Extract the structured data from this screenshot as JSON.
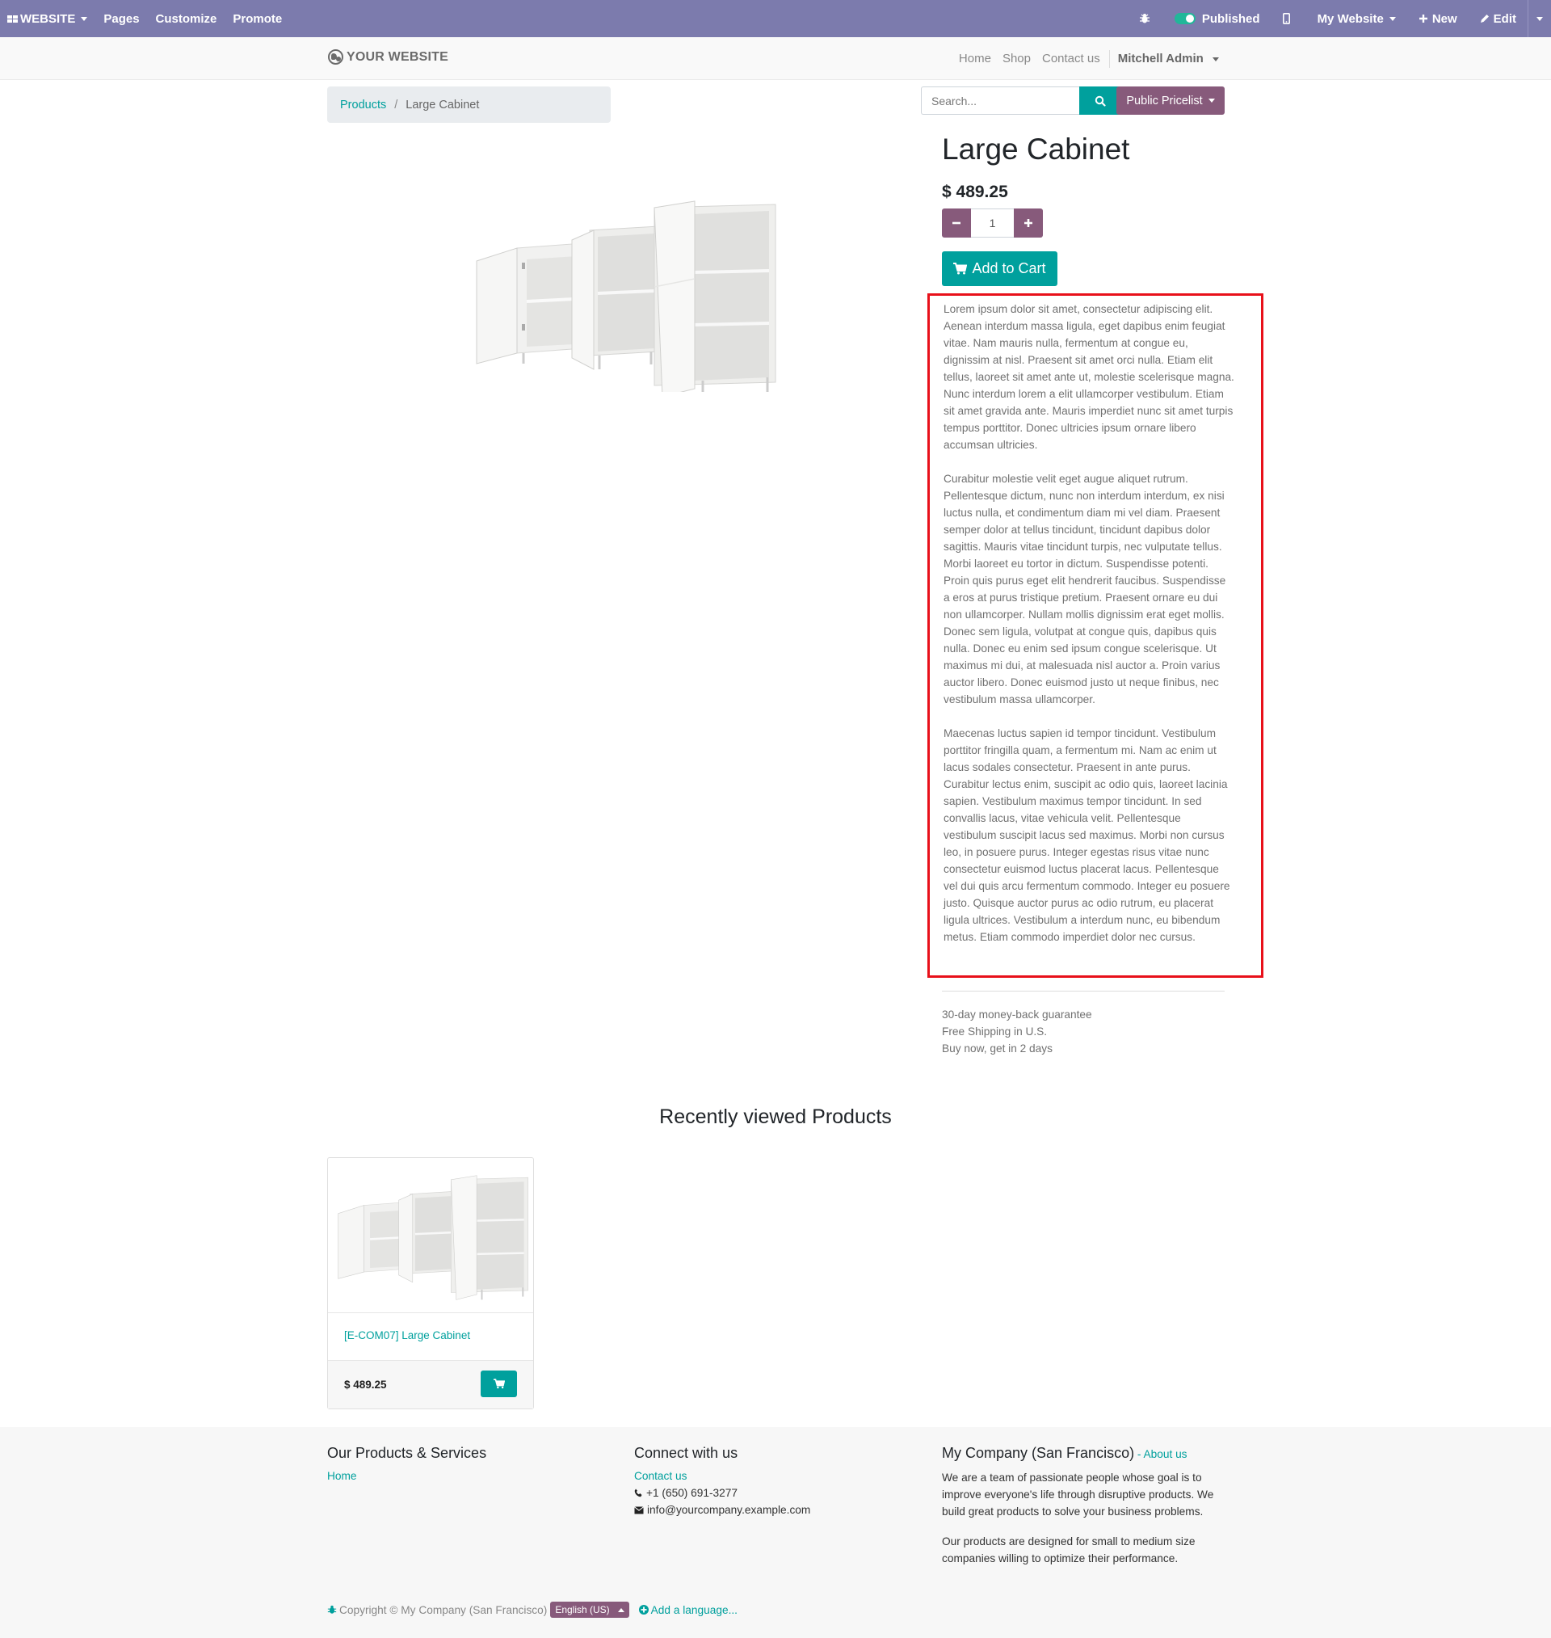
{
  "adminbar": {
    "apps_label": "WEBSITE",
    "pages_label": "Pages",
    "customize_label": "Customize",
    "promote_label": "Promote",
    "published_label": "Published",
    "site_label": "My Website",
    "new_label": "New",
    "edit_label": "Edit"
  },
  "header": {
    "logo_text": "YOUR WEBSITE",
    "nav": [
      "Home",
      "Shop",
      "Contact us"
    ],
    "user": "Mitchell Admin"
  },
  "breadcrumb": {
    "parent": "Products",
    "separator": "/",
    "current": "Large Cabinet"
  },
  "search": {
    "placeholder": "Search..."
  },
  "pricelist": {
    "label": "Public Pricelist"
  },
  "product": {
    "name": "Large Cabinet",
    "price": "$ 489.25",
    "quantity": "1",
    "add_to_cart_label": "Add to Cart",
    "description": [
      "Lorem ipsum dolor sit amet, consectetur adipiscing elit. Aenean interdum massa ligula, eget dapibus enim feugiat vitae. Nam mauris nulla, fermentum at congue eu, dignissim at nisl. Praesent sit amet orci nulla. Etiam elit tellus, laoreet sit amet ante ut, molestie scelerisque magna. Nunc interdum lorem a elit ullamcorper vestibulum. Etiam sit amet gravida ante. Mauris imperdiet nunc sit amet turpis tempus porttitor. Donec ultricies ipsum ornare libero accumsan ultricies.",
      "Curabitur molestie velit eget augue aliquet rutrum. Pellentesque dictum, nunc non interdum interdum, ex nisi luctus nulla, et condimentum diam mi vel diam. Praesent semper dolor at tellus tincidunt, tincidunt dapibus dolor sagittis. Mauris vitae tincidunt turpis, nec vulputate tellus. Morbi laoreet eu tortor in dictum. Suspendisse potenti. Proin quis purus eget elit hendrerit faucibus. Suspendisse a eros at purus tristique pretium. Praesent ornare eu dui non ullamcorper. Nullam mollis dignissim erat eget mollis. Donec sem ligula, volutpat at congue quis, dapibus quis nulla. Donec eu enim sed ipsum congue scelerisque. Ut maximus mi dui, at malesuada nisl auctor a. Proin varius auctor libero. Donec euismod justo ut neque finibus, nec vestibulum massa ullamcorper.",
      "Maecenas luctus sapien id tempor tincidunt. Vestibulum porttitor fringilla quam, a fermentum mi. Nam ac enim ut lacus sodales consectetur. Praesent in ante purus. Curabitur lectus enim, suscipit ac odio quis, laoreet lacinia sapien. Vestibulum maximus tempor tincidunt. In sed convallis lacus, vitae vehicula velit. Pellentesque vestibulum suscipit lacus sed maximus. Morbi non cursus leo, in posuere purus. Integer egestas risus vitae nunc consectetur euismod luctus placerat lacus. Pellentesque vel dui quis arcu fermentum commodo. Integer eu posuere justo. Quisque auctor purus ac odio rutrum, eu placerat ligula ultrices. Vestibulum a interdum nunc, eu bibendum metus. Etiam commodo imperdiet dolor nec cursus."
    ],
    "guarantees": [
      "30-day money-back guarantee",
      "Free Shipping in U.S.",
      "Buy now, get in 2 days"
    ]
  },
  "recent": {
    "title": "Recently viewed Products",
    "items": [
      {
        "name": "[E-COM07] Large Cabinet",
        "price": "$ 489.25"
      }
    ]
  },
  "footer": {
    "col1": {
      "title": "Our Products & Services",
      "link": "Home"
    },
    "col2": {
      "title": "Connect with us",
      "contact": "Contact us",
      "phone": "+1 (650) 691-3277",
      "email": "info@yourcompany.example.com"
    },
    "col3": {
      "title": "My Company (San Francisco)",
      "about_sep": " - ",
      "about_link": "About us",
      "p1": "We are a team of passionate people whose goal is to improve everyone's life through disruptive products. We build great products to solve your business problems.",
      "p2": "Our products are designed for small to medium size companies willing to optimize their performance."
    },
    "copyright": "Copyright © My Company (San Francisco)",
    "language": "English (US)",
    "add_language": "Add a language..."
  },
  "colors": {
    "adminbar": "#7c7bad",
    "primary": "#00a09d",
    "secondary": "#875a7b",
    "highlight_box": "#e8101a"
  }
}
